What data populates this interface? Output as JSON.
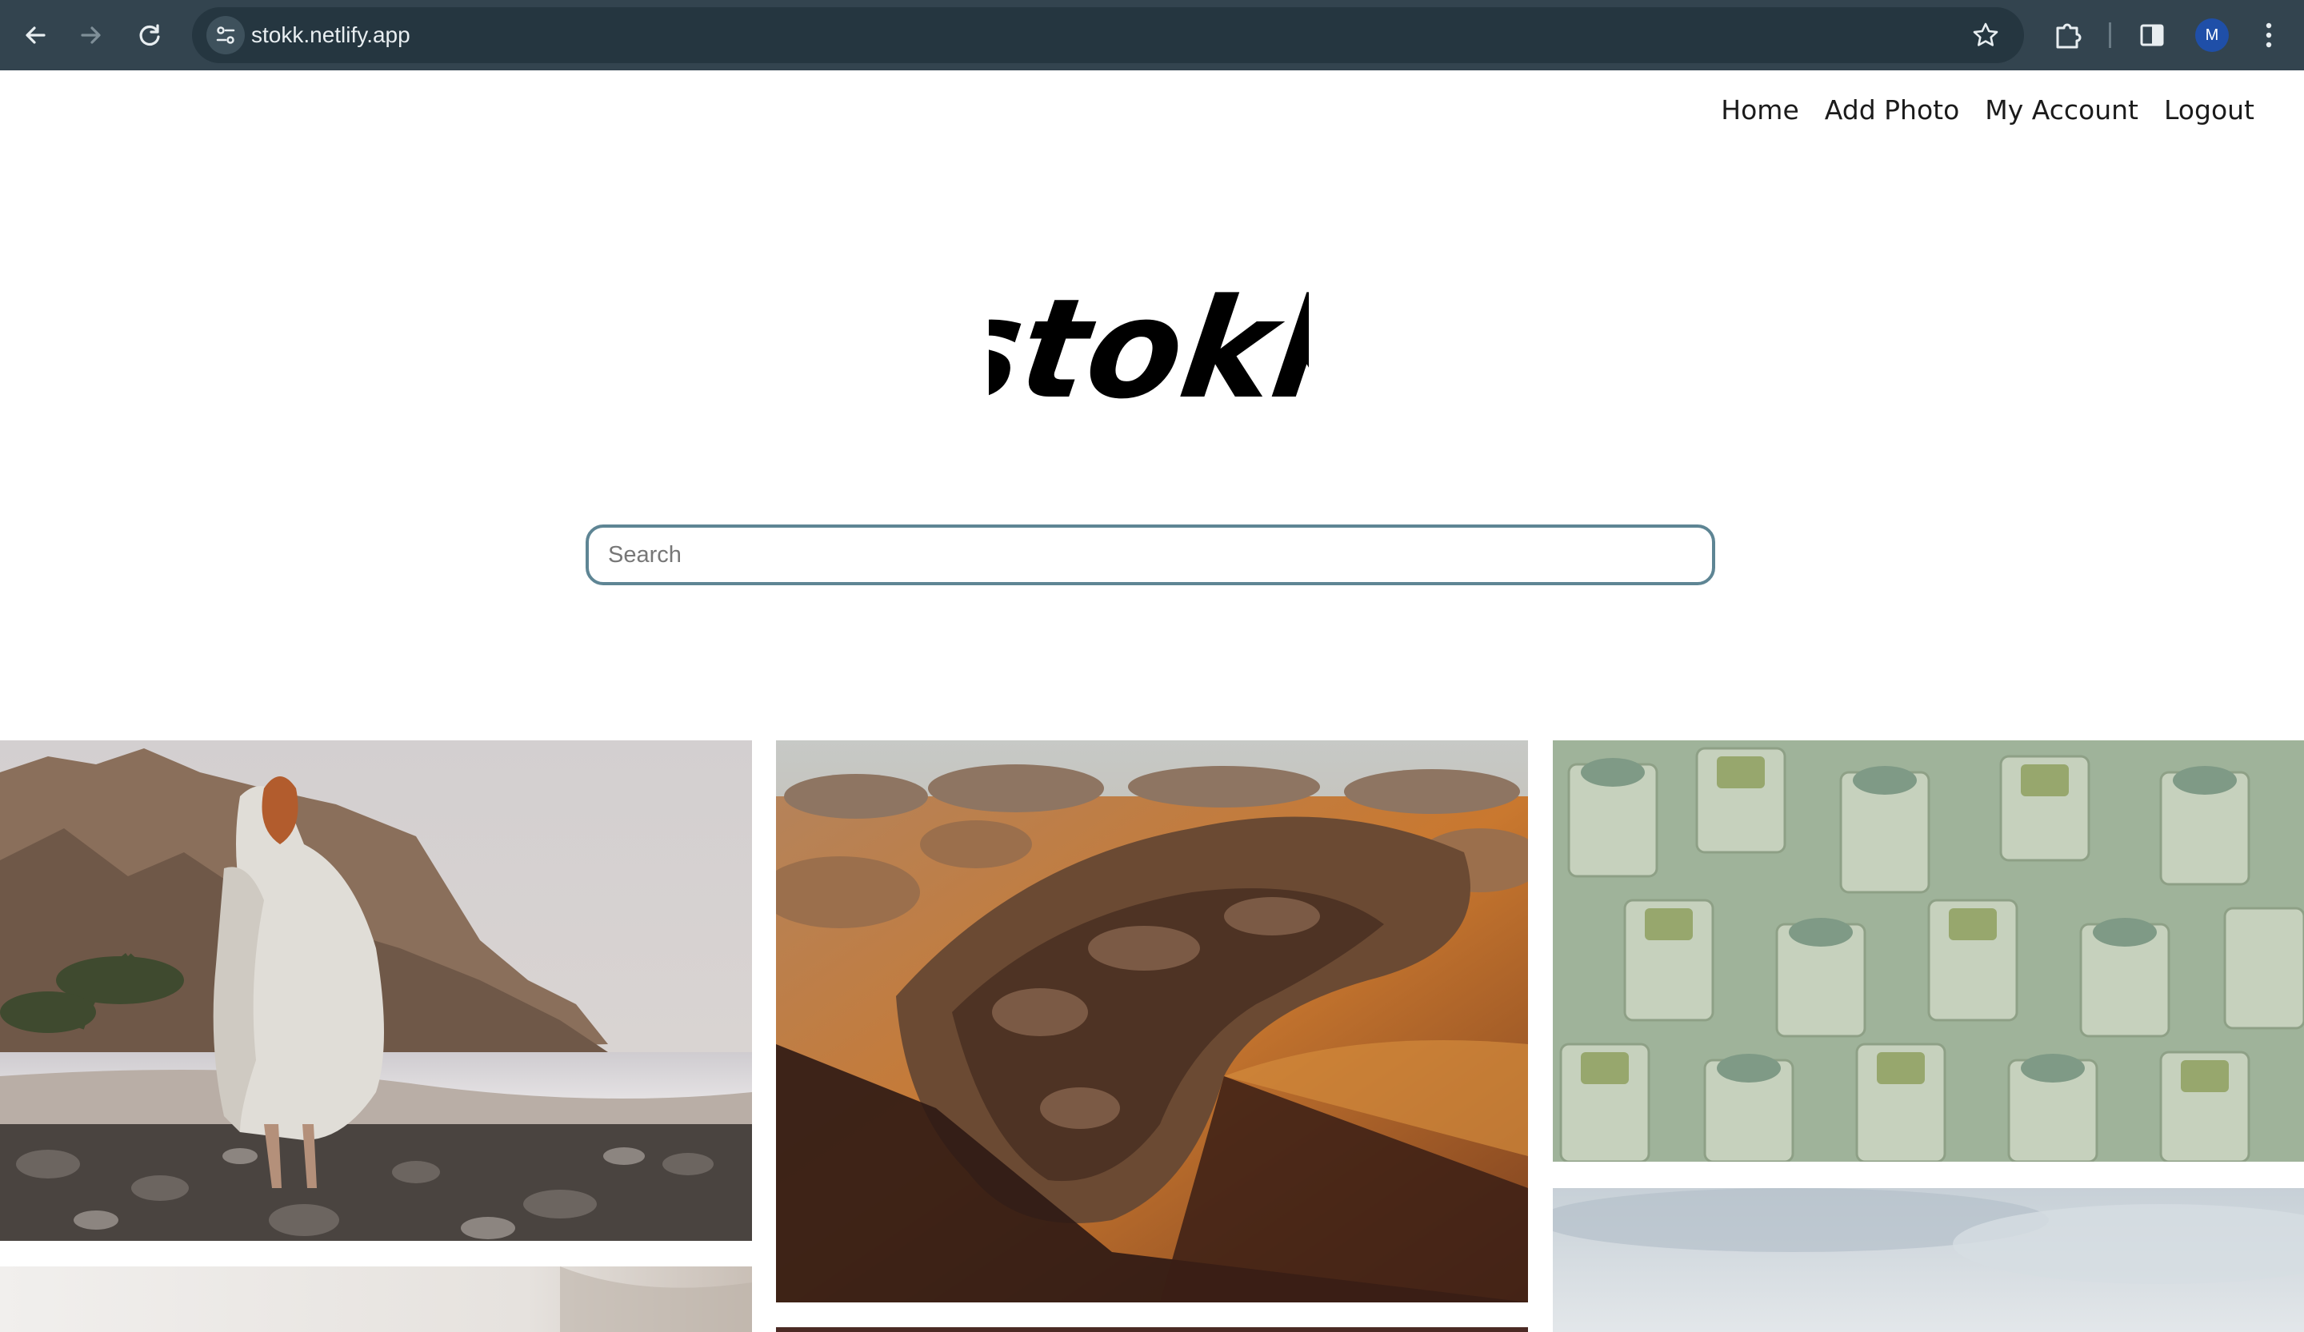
{
  "browser": {
    "url": "stokk.netlify.app",
    "profile_initial": "M",
    "icons": [
      "back-arrow-icon",
      "forward-arrow-icon",
      "reload-icon",
      "site-info-icon",
      "bookmark-star-icon",
      "extensions-puzzle-icon",
      "side-panel-icon",
      "menu-dots-icon"
    ]
  },
  "nav": {
    "home": "Home",
    "add_photo": "Add Photo",
    "my_account": "My Account",
    "logout": "Logout"
  },
  "logo": {
    "text": "stokk"
  },
  "search": {
    "placeholder": "Search",
    "value": ""
  },
  "gallery": {
    "photos": [
      {
        "name": "woman-on-rocky-beach",
        "alt_colors": [
          "#d8d4d2",
          "#7a5f4c",
          "#3a3633"
        ]
      },
      {
        "name": "aerial-desert-rocks",
        "alt_colors": [
          "#b8a98f",
          "#6b4a33",
          "#c47a35"
        ]
      },
      {
        "name": "green-geometric-cylinders",
        "alt_colors": [
          "#9fb49a",
          "#7f9a86",
          "#c9d3bf"
        ]
      },
      {
        "name": "misty-cloudy-sky",
        "alt_colors": [
          "#d9dfe4",
          "#b7c3cc"
        ]
      },
      {
        "name": "hazy-landscape",
        "alt_colors": [
          "#e7e5e2",
          "#c4bdb6"
        ]
      },
      {
        "name": "dark-reddish-photo",
        "alt_colors": [
          "#4b2a24",
          "#8a4a3a"
        ]
      }
    ]
  }
}
